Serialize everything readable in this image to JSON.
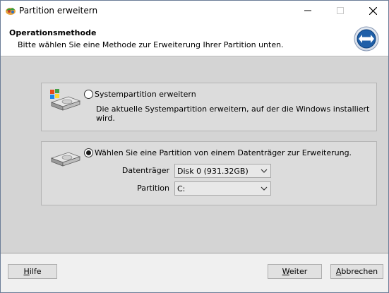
{
  "window": {
    "title": "Partition erweitern",
    "controls": {
      "minimize": "minimize",
      "maximize": "maximize",
      "close": "close"
    }
  },
  "header": {
    "title": "Operationsmethode",
    "subtitle": "Bitte wählen Sie eine Methode zur Erweiterung Ihrer Partition unten."
  },
  "options": [
    {
      "label": "Systempartition erweitern",
      "description": "Die aktuelle Systempartition erweitern, auf der die Windows installiert wird.",
      "selected": false
    },
    {
      "label": "Wählen Sie eine Partition von einem Datenträger zur Erweiterung.",
      "selected": true,
      "fields": {
        "disk_label": "Datenträger",
        "disk_value": "Disk 0 (931.32GB)",
        "partition_label": "Partition",
        "partition_value": "C:"
      }
    }
  ],
  "buttons": {
    "help_first": "H",
    "help_rest": "ilfe",
    "next_first": "W",
    "next_rest": "eiter",
    "cancel_first": "A",
    "cancel_rest": "bbrechen"
  },
  "colors": {
    "accent": "#1f5fa8",
    "body_bg": "#d4d4d4",
    "group_bg": "#dcdcdc"
  }
}
